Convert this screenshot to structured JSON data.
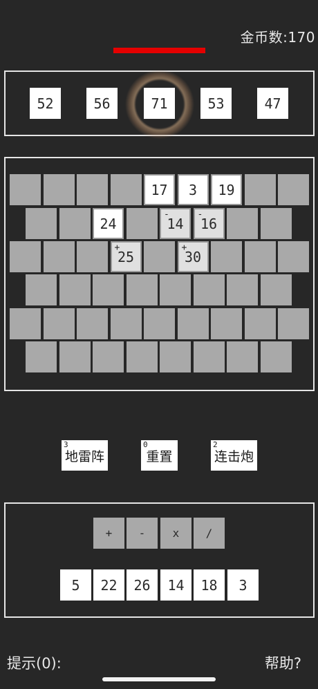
{
  "header": {
    "coins_label": "金币数:170"
  },
  "health_bar": {
    "color": "#e50000"
  },
  "targets": [
    "52",
    "56",
    "71",
    "53",
    "47"
  ],
  "board": {
    "rows": [
      [
        "",
        "",
        "",
        "",
        "17",
        "3",
        "19",
        "",
        ""
      ],
      [
        "",
        "",
        "24",
        "",
        "14",
        "16",
        "",
        ""
      ],
      [
        "",
        "",
        "",
        "25",
        "",
        "30",
        "",
        "",
        ""
      ],
      [
        "",
        "",
        "",
        "",
        "",
        "",
        "",
        ""
      ],
      [
        "",
        "",
        "",
        "",
        "",
        "",
        "",
        "",
        ""
      ],
      [
        "",
        "",
        "",
        "",
        "",
        "",
        "",
        ""
      ]
    ],
    "signs": {
      "1-4": "-",
      "1-5": "-",
      "2-3": "+",
      "2-5": "+"
    }
  },
  "skills": [
    {
      "count": "3",
      "label": "地雷阵"
    },
    {
      "count": "0",
      "label": "重置"
    },
    {
      "count": "2",
      "label": "连击炮"
    }
  ],
  "operators": [
    "+",
    "-",
    "x",
    "/"
  ],
  "numbers": [
    "5",
    "22",
    "26",
    "14",
    "18",
    "3"
  ],
  "footer": {
    "hint_label": "提示(0):",
    "help_label": "帮助?"
  }
}
